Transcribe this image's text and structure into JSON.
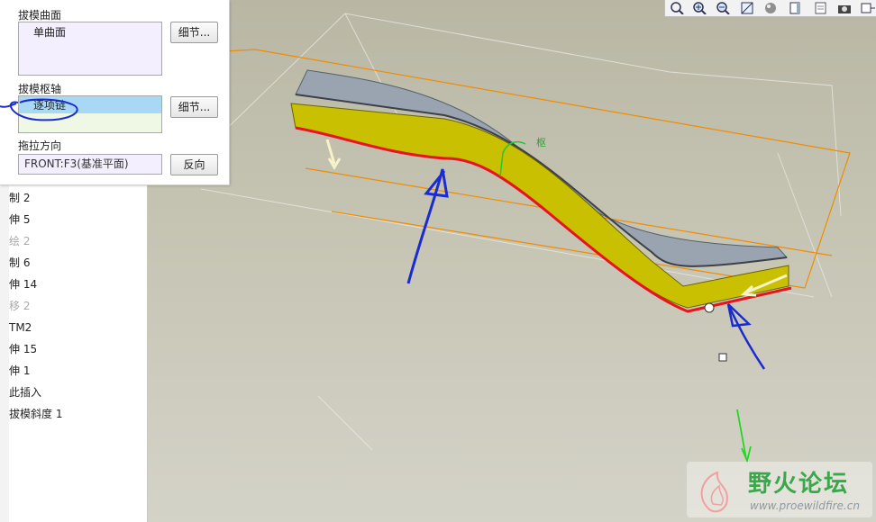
{
  "draft_panel": {
    "surfaces_label": "拔模曲面",
    "surfaces_value": "单曲面",
    "surfaces_details_button": "细节...",
    "hinges_label": "拔模枢轴",
    "hinges_value": "逐项链",
    "hinges_details_button": "细节...",
    "pull_direction_label": "拖拉方向",
    "pull_direction_value": "FRONT:F3(基准平面)",
    "flip_button": "反向"
  },
  "model_tree": {
    "items": [
      {
        "label": "制 2",
        "suppressed": false
      },
      {
        "label": "伸 5",
        "suppressed": false
      },
      {
        "label": "绘 2",
        "suppressed": true
      },
      {
        "label": "制 6",
        "suppressed": false
      },
      {
        "label": "伸 14",
        "suppressed": false
      },
      {
        "label": "移 2",
        "suppressed": true
      },
      {
        "label": "TM2",
        "suppressed": false
      },
      {
        "label": "伸 15",
        "suppressed": false
      },
      {
        "label": "伸 1",
        "suppressed": false
      },
      {
        "label": "此插入",
        "suppressed": false
      },
      {
        "label": "拔模斜度 1",
        "suppressed": false
      }
    ]
  },
  "viewport": {
    "annotation_label": "枢",
    "colors": {
      "background_top": "#b9b7a4",
      "draft_face": "#c8c000",
      "top_face": "#9aa4b0",
      "hinge_edge": "#e8141c",
      "datum_plane": "#f08c00",
      "annotation": "#1a2cd0",
      "drag_arrow": "#2ad82a"
    }
  },
  "toolbar": {
    "icons": [
      "zoom-fit-icon",
      "zoom-in-icon",
      "zoom-out-icon",
      "repaint-icon",
      "shading-icon",
      "saved-views-icon",
      "layers-icon",
      "camera-icon",
      "expand-icon"
    ]
  },
  "watermark": {
    "title": "野火论坛",
    "url": "www.proewildfire.cn"
  }
}
